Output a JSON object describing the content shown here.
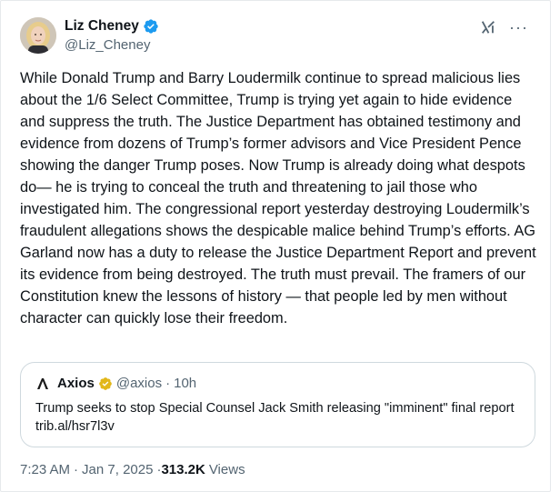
{
  "author": {
    "name": "Liz Cheney",
    "handle": "@Liz_Cheney"
  },
  "icons": {
    "verified": "verified-badge-icon",
    "grok": "grok-icon",
    "more": "more-icon"
  },
  "tweet": {
    "text": "While Donald Trump and Barry Loudermilk continue to spread malicious lies about the 1/6 Select Committee, Trump is trying yet again to hide evidence and suppress the truth.  The Justice Department has obtained testimony and evidence from dozens of Trump’s former advisors and Vice President Pence showing the danger Trump poses. Now Trump is already doing what despots do— he is trying to conceal the truth and threatening to jail those who investigated him. The congressional report yesterday destroying Loudermilk’s fraudulent allegations shows the despicable malice behind Trump’s efforts.  AG Garland now has a duty to release the Justice Department Report and prevent its evidence from being destroyed. The truth must prevail.  The framers of our Constitution knew the lessons of history —  that people led by men without character can quickly lose their freedom."
  },
  "quote": {
    "name": "Axios",
    "handle": "@axios",
    "dot": "·",
    "time": "10h",
    "text": "Trump seeks to stop Special Counsel Jack Smith releasing \"imminent\" final report trib.al/hsr7l3v"
  },
  "meta": {
    "time": "7:23 AM",
    "dot": "·",
    "date": "Jan 7, 2025",
    "dot2": "·",
    "views_count": "313.2K",
    "views_label": "Views"
  },
  "colors": {
    "text": "#0f1419",
    "secondary": "#536471",
    "verified_blue": "#1d9bf0",
    "verified_gold": "#e2b719",
    "border": "#cfd9de"
  }
}
